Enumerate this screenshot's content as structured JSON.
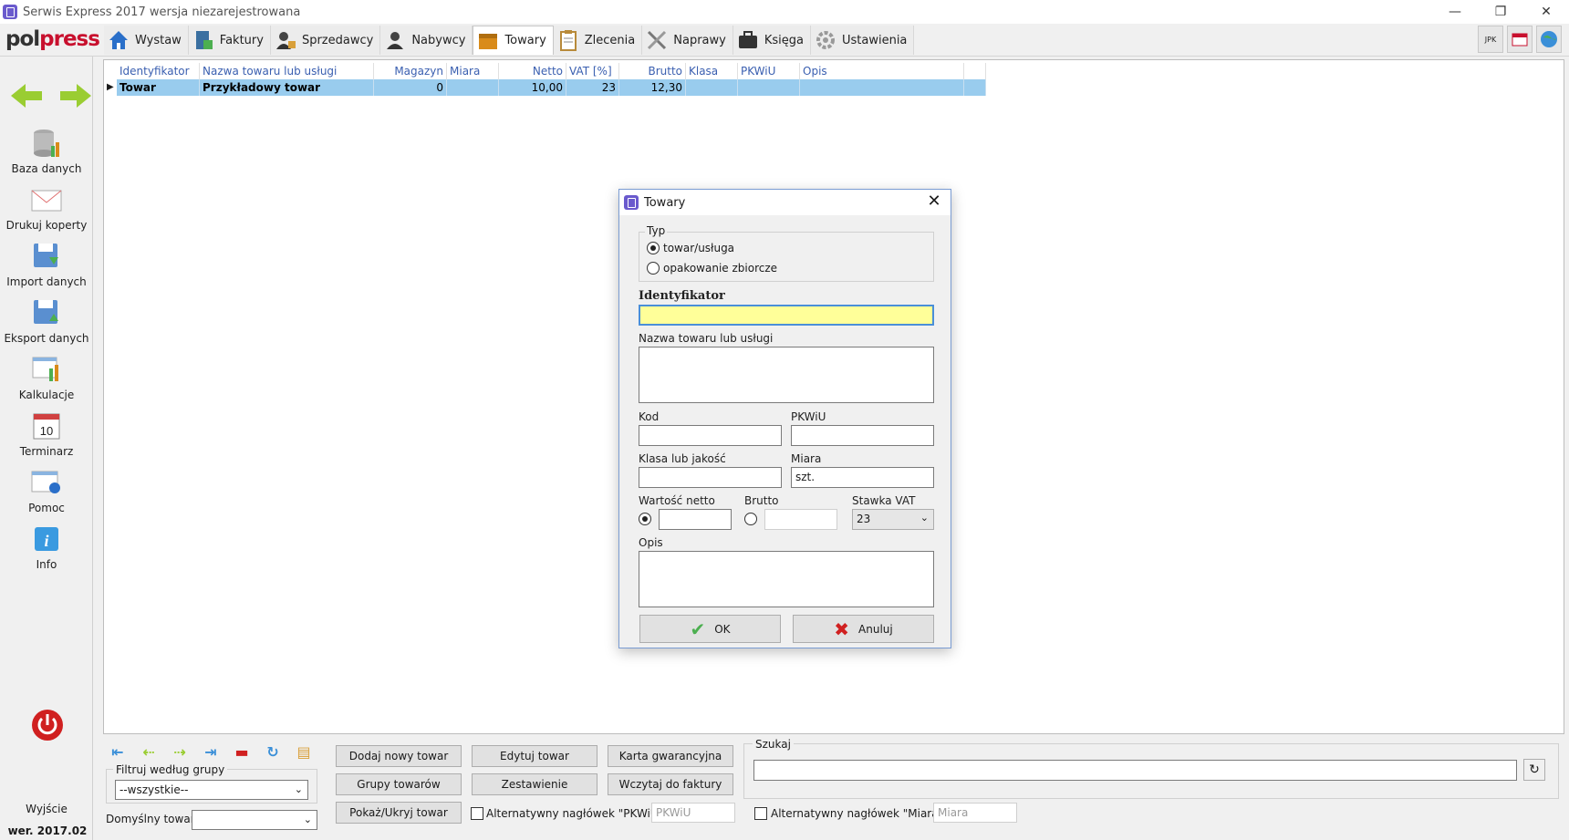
{
  "window": {
    "title": "Serwis Express 2017 wersja niezarejestrowana",
    "controls": [
      "—",
      "❐",
      "✕"
    ]
  },
  "logo": {
    "part1": "pol",
    "part2": "press"
  },
  "tabs": [
    {
      "label": "Wystaw",
      "icon": "home-icon",
      "color": "#2a6fc9"
    },
    {
      "label": "Faktury",
      "icon": "invoice-icon",
      "color": "#3a7a3a"
    },
    {
      "label": "Sprzedawcy",
      "icon": "seller-icon",
      "color": "#555"
    },
    {
      "label": "Nabywcy",
      "icon": "buyer-icon",
      "color": "#555"
    },
    {
      "label": "Towary",
      "icon": "goods-box-icon",
      "color": "#d98b1a"
    },
    {
      "label": "Zlecenia",
      "icon": "clipboard-icon",
      "color": "#c9a24a"
    },
    {
      "label": "Naprawy",
      "icon": "tools-icon",
      "color": "#777"
    },
    {
      "label": "Księga",
      "icon": "briefcase-icon",
      "color": "#333"
    },
    {
      "label": "Ustawienia",
      "icon": "gear-icon",
      "color": "#999"
    }
  ],
  "top_right": {
    "jpk": "JPK"
  },
  "sidebar": {
    "items": [
      {
        "label": "Baza danych",
        "icon": "database-icon"
      },
      {
        "label": "Drukuj koperty",
        "icon": "envelope-icon"
      },
      {
        "label": "Import danych",
        "icon": "import-icon"
      },
      {
        "label": "Eksport danych",
        "icon": "export-icon"
      },
      {
        "label": "Kalkulacje",
        "icon": "calculations-icon"
      },
      {
        "label": "Terminarz",
        "icon": "calendar-icon",
        "day": "10"
      },
      {
        "label": "Pomoc",
        "icon": "help-icon"
      },
      {
        "label": "Info",
        "icon": "info-icon",
        "glyph": "i"
      }
    ],
    "exit_label": "Wyjście",
    "version": "wer. 2017.02"
  },
  "grid": {
    "columns": [
      "Identyfikator",
      "Nazwa towaru lub usługi",
      "Magazyn",
      "Miara",
      "Netto",
      "VAT [%]",
      "Brutto",
      "Klasa",
      "PKWiU",
      "Opis"
    ],
    "rows": [
      {
        "identyfikator": "Towar",
        "nazwa": "Przykładowy towar",
        "magazyn": "0",
        "miara": "",
        "netto": "10,00",
        "vat": "23",
        "brutto": "12,30",
        "klasa": "",
        "pkwiu": "",
        "opis": ""
      }
    ]
  },
  "dialog": {
    "title": "Towary",
    "type_group": "Typ",
    "type_options": [
      "towar/usługa",
      "opakowanie zbiorcze"
    ],
    "selected_type": 0,
    "identyfikator_label": "Identyfikator",
    "identyfikator_value": "",
    "nazwa_label": "Nazwa towaru lub usługi",
    "kod_label": "Kod",
    "pkwiu_label": "PKWiU",
    "klasa_label": "Klasa lub jakość",
    "miara_label": "Miara",
    "miara_value": "szt.",
    "netto_label": "Wartość netto",
    "brutto_label": "Brutto",
    "stawka_label": "Stawka VAT",
    "stawka_value": "23",
    "opis_label": "Opis",
    "ok_label": "OK",
    "cancel_label": "Anuluj"
  },
  "bottom": {
    "filter_title": "Filtruj według grupy",
    "filter_value": "--wszystkie--",
    "default_label": "Domyślny towar",
    "buttons": {
      "add": "Dodaj nowy towar",
      "edit": "Edytuj towar",
      "warranty": "Karta gwarancyjna",
      "groups": "Grupy towarów",
      "summary": "Zestawienie",
      "load": "Wczytaj do faktury",
      "toggle": "Pokaż/Ukryj towar"
    },
    "alt_pkwiu_label": "Alternatywny nagłówek \"PKWiU\"",
    "alt_pkwiu_placeholder": "PKWiU",
    "alt_miara_label": "Alternatywny nagłówek \"Miara\"",
    "alt_miara_placeholder": "Miara",
    "search_title": "Szukaj"
  }
}
